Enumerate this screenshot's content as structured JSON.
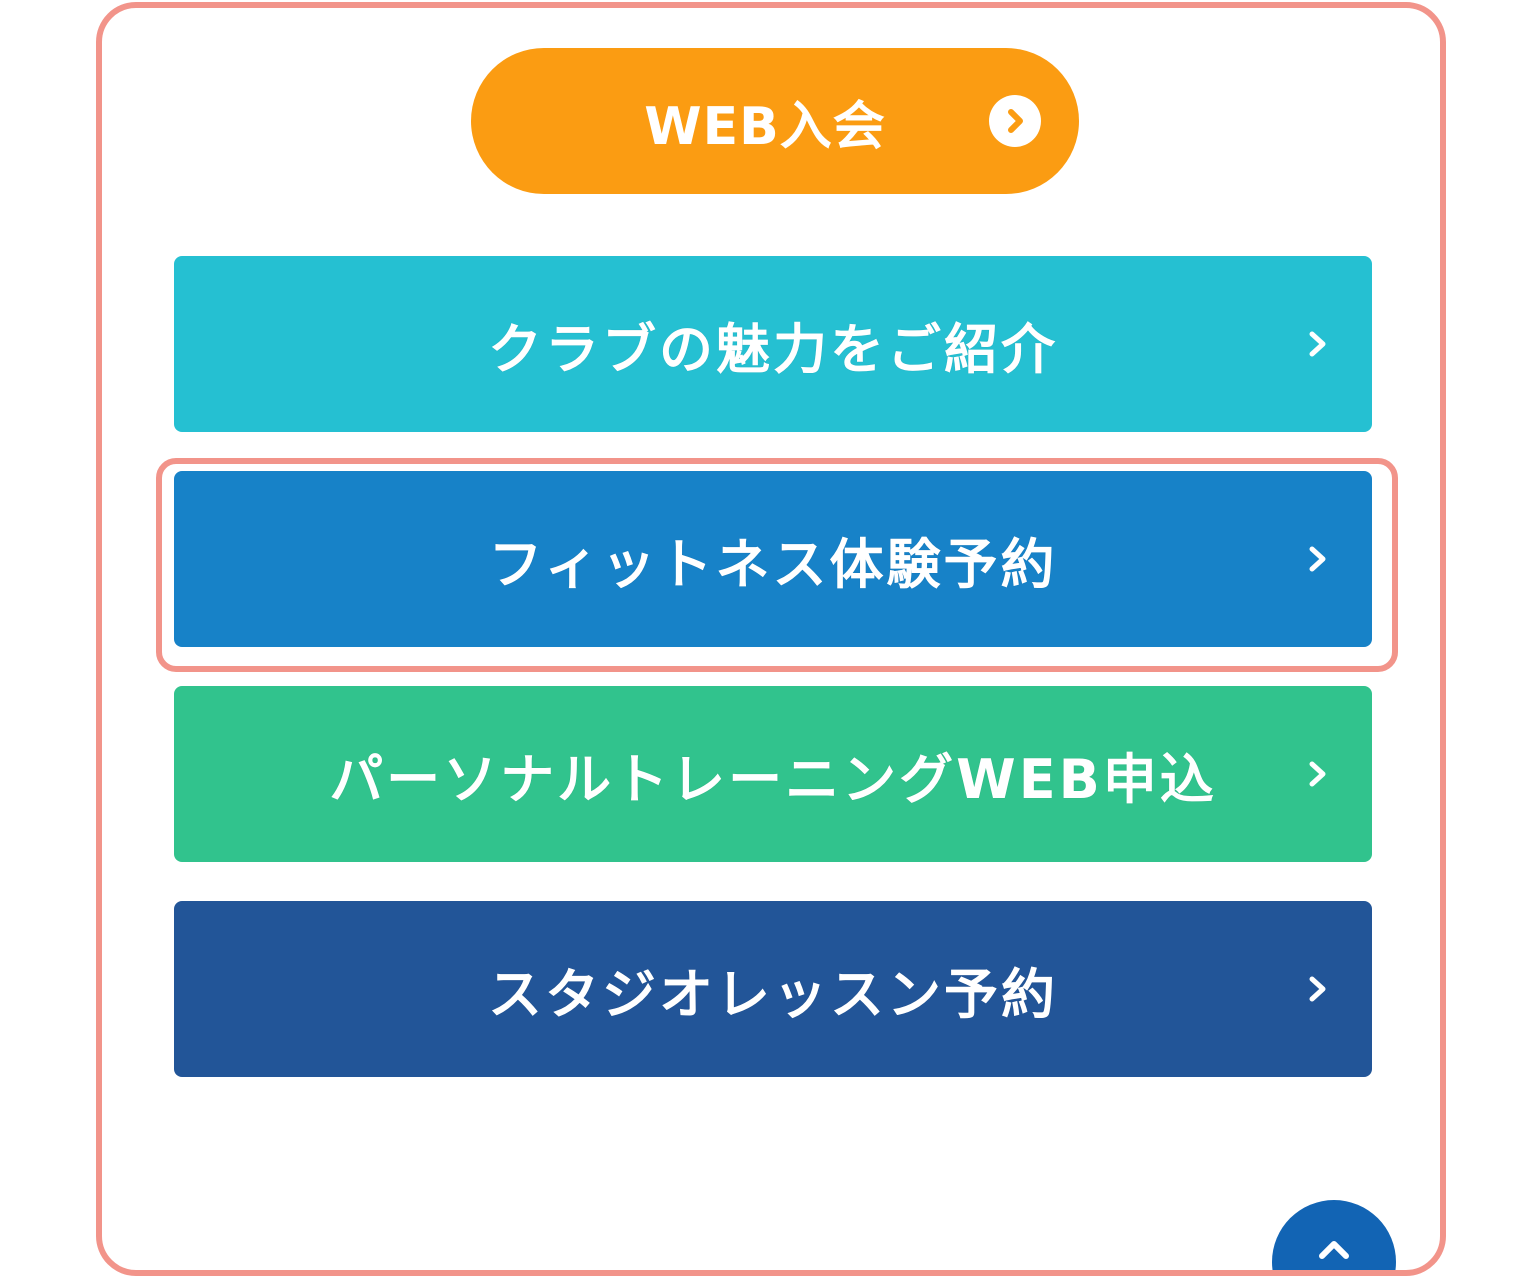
{
  "join_button": {
    "label": "WEB入会",
    "color": "#fb9c12",
    "icon": "chevron-circle-right-icon"
  },
  "menu": {
    "items": [
      {
        "label": "クラブの魅力をご紹介",
        "color": "#25c0d2",
        "icon": "chevron-right-icon"
      },
      {
        "label": "フィットネス体験予約",
        "color": "#1782c8",
        "icon": "chevron-right-icon",
        "focused": true
      },
      {
        "label": "パーソナルトレーニングWEB申込",
        "color": "#31c38d",
        "icon": "chevron-right-icon"
      },
      {
        "label": "スタジオレッスン予約",
        "color": "#225598",
        "icon": "chevron-right-icon"
      }
    ]
  },
  "scroll_top": {
    "icon": "chevron-up-icon",
    "color": "#1264b4"
  },
  "accent": {
    "frame": "#f2948a"
  }
}
